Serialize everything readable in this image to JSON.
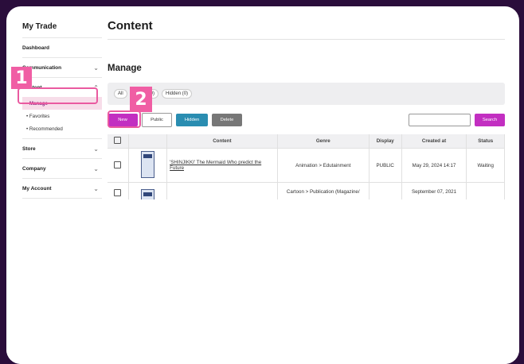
{
  "sidebar": {
    "brand": "My Trade",
    "items": [
      {
        "label": "Dashboard",
        "chevron": false
      },
      {
        "label": "Communication",
        "chevron": true
      },
      {
        "label": "Content",
        "chevron": true,
        "expanded": true
      }
    ],
    "content_subitems": [
      "Manage",
      "Favorites",
      "Recommended"
    ],
    "items_after": [
      {
        "label": "Store"
      },
      {
        "label": "Company"
      },
      {
        "label": "My Account"
      }
    ]
  },
  "header": {
    "title": "Content"
  },
  "main": {
    "section_title": "Manage",
    "filters": [
      "All",
      "Public (0)",
      "Hidden (0)"
    ],
    "toolbar": {
      "new": "New",
      "public": "Public",
      "hidden": "Hidden",
      "delete": "Delete",
      "search_placeholder": "",
      "search": "Search"
    },
    "table": {
      "headers": [
        "",
        "",
        "Content",
        "Genre",
        "Display",
        "Created at",
        "Status"
      ],
      "rows": [
        {
          "content": "'SHINJIKKI' The Mermaid Who predict the Future",
          "genre": "Animation > Edutainment",
          "display": "PUBLIC",
          "created": "May 29, 2024 14:17",
          "status": "Waiting"
        },
        {
          "content": "",
          "genre": "Cartoon > Publication (Magazine/",
          "display": "",
          "created": "September 07, 2021",
          "status": ""
        }
      ]
    }
  },
  "callouts": [
    "1",
    "2"
  ],
  "colors": {
    "accent": "#c22fc1",
    "highlight": "#ea5aa0",
    "hidden_btn": "#2a8db1"
  }
}
